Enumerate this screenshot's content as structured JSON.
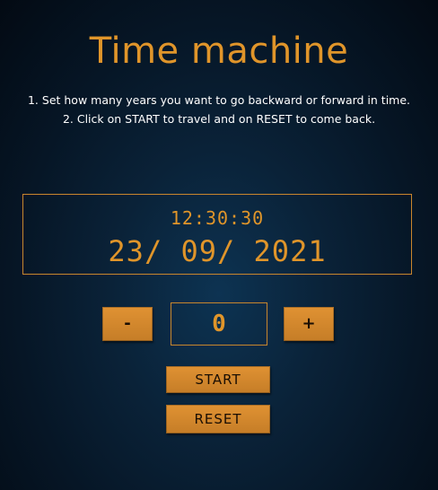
{
  "app": {
    "title": "Time machine"
  },
  "instructions": {
    "step1": "1. Set how many years you want to go backward or forward in time.",
    "step2": "2. Click on START to travel and on RESET to come back."
  },
  "display": {
    "time": "12:30:30",
    "date": "23/ 09/ 2021"
  },
  "controls": {
    "decrement_label": "-",
    "increment_label": "+",
    "years_value": "0",
    "start_label": "START",
    "reset_label": "RESET"
  },
  "colors": {
    "accent": "#e0952a",
    "button_fill": "#d28a2e",
    "border": "#c9862d",
    "background_center": "#0d3352",
    "background_edge": "#030a13"
  }
}
